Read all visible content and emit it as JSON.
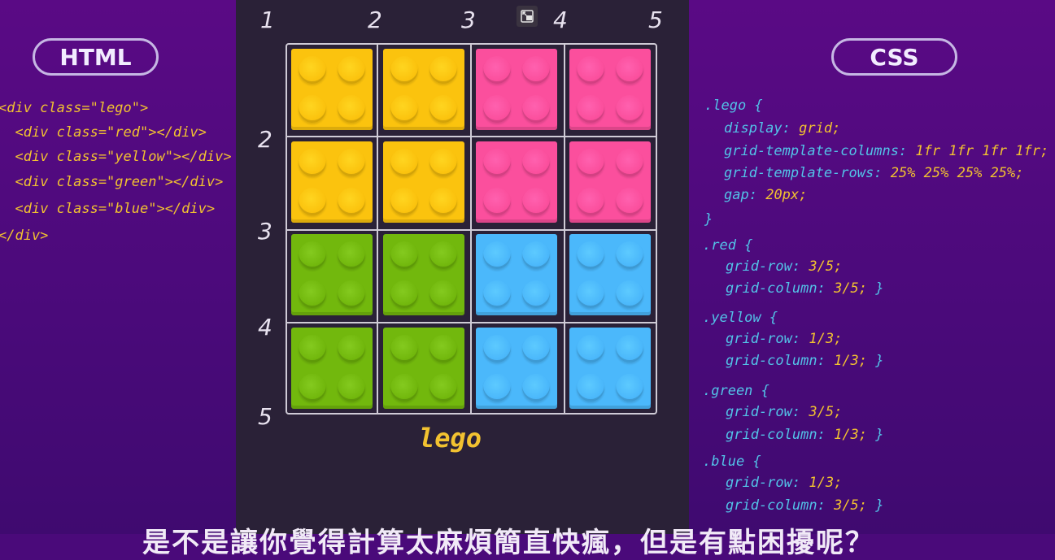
{
  "html_panel": {
    "label": "HTML",
    "lines": [
      "<div class=\"lego\">",
      "  <div class=\"red\"></div>",
      "  <div class=\"yellow\"></div>",
      "  <div class=\"green\"></div>",
      "  <div class=\"blue\"></div>",
      "</div>"
    ]
  },
  "css_panel": {
    "label": "CSS",
    "rules": [
      {
        "selector": ".lego {",
        "decls": [
          {
            "prop": "display:",
            "val": "grid;"
          },
          {
            "prop": "grid-template-columns:",
            "val": "1fr 1fr 1fr 1fr;"
          },
          {
            "prop": "grid-template-rows:",
            "val": "25% 25% 25% 25%;"
          },
          {
            "prop": "gap:",
            "val": "20px;"
          }
        ],
        "close": "}"
      },
      {
        "selector": ".red {",
        "decls": [
          {
            "prop": "grid-row:",
            "val": "3/5;"
          },
          {
            "prop": "grid-column:",
            "val": "3/5;",
            "tail": "}"
          }
        ]
      },
      {
        "selector": ".yellow {",
        "decls": [
          {
            "prop": "grid-row:",
            "val": "1/3;"
          },
          {
            "prop": "grid-column:",
            "val": "1/3;",
            "tail": "}"
          }
        ]
      },
      {
        "selector": ".green {",
        "decls": [
          {
            "prop": "grid-row:",
            "val": "3/5;"
          },
          {
            "prop": "grid-column:",
            "val": "1/3;",
            "tail": "}"
          }
        ]
      },
      {
        "selector": ".blue {",
        "decls": [
          {
            "prop": "grid-row:",
            "val": "1/3;"
          },
          {
            "prop": "grid-column:",
            "val": "3/5;",
            "tail": "}"
          }
        ]
      }
    ]
  },
  "grid": {
    "column_numbers": [
      "1",
      "2",
      "3",
      "4",
      "5"
    ],
    "row_numbers": [
      "2",
      "3",
      "4",
      "5"
    ],
    "label": "lego",
    "cells": [
      [
        "yellow",
        "yellow",
        "pink",
        "pink"
      ],
      [
        "yellow",
        "yellow",
        "pink",
        "pink"
      ],
      [
        "green",
        "green",
        "blue",
        "blue"
      ],
      [
        "green",
        "green",
        "blue",
        "blue"
      ]
    ]
  },
  "colors": {
    "yellow": "#fbc30e",
    "pink": "#fb4f9d",
    "green": "#72b80d",
    "blue": "#4bb8fb"
  },
  "subtitle": "是不是讓你覺得計算太麻煩簡直快瘋，但是有點困擾呢？"
}
